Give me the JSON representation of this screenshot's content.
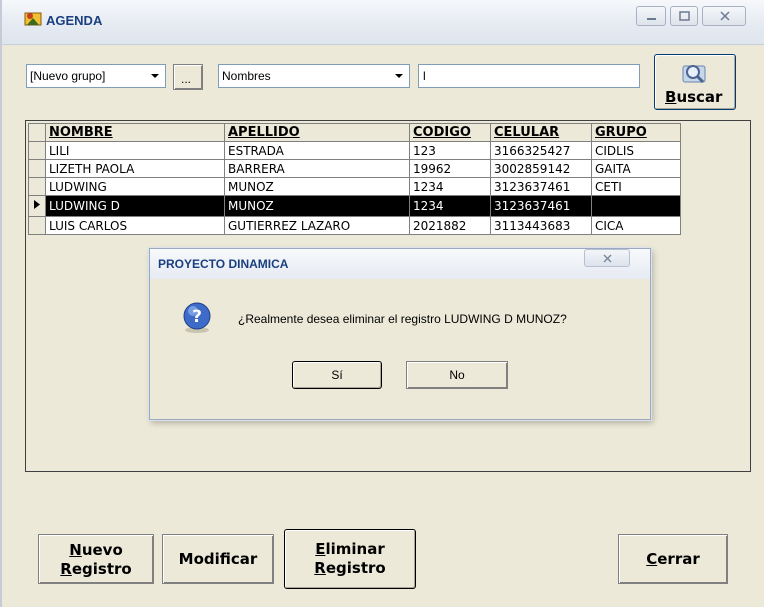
{
  "window": {
    "title": "AGENDA"
  },
  "toolbar": {
    "group_combo": "[Nuevo grupo]",
    "ellipsis": "...",
    "field_combo": "Nombres",
    "search_value": "l",
    "search_button": {
      "mnemonic": "B",
      "rest": "uscar"
    }
  },
  "table": {
    "headers": [
      "NOMBRE",
      "APELLIDO",
      "CODIGO",
      "CELULAR",
      "GRUPO"
    ],
    "rows": [
      [
        "LILI",
        "ESTRADA",
        "123",
        "3166325427",
        "CIDLIS"
      ],
      [
        "LIZETH PAOLA",
        "BARRERA",
        "19962",
        "3002859142",
        "GAITA"
      ],
      [
        "LUDWING",
        "MUNOZ",
        "1234",
        "3123637461",
        "CETI"
      ],
      [
        "LUDWING D",
        "MUNOZ",
        "1234",
        "3123637461",
        ""
      ],
      [
        "LUIS CARLOS",
        "GUTIERREZ LAZARO",
        "2021882",
        "3113443683",
        "CICA"
      ]
    ],
    "selected_index": 3
  },
  "dialog": {
    "title": "PROYECTO DINAMICA",
    "message": "¿Realmente desea eliminar el registro LUDWING D MUNOZ?",
    "yes": "Sí",
    "no": "No"
  },
  "buttons": {
    "nuevo": {
      "line1_mn": "N",
      "line1_rest": "uevo",
      "line2_mn": "R",
      "line2_rest": "egistro"
    },
    "modificar": "Modificar",
    "eliminar": {
      "line1_mn": "E",
      "line1_rest": "liminar",
      "line2_mn": "R",
      "line2_rest": "egistro"
    },
    "cerrar": {
      "mn": "C",
      "rest": "errar"
    }
  },
  "colors": {
    "title_text": "#1a3f80",
    "selected_row": "#000000",
    "window_bg": "#ece9d8"
  },
  "icons": [
    "agenda-app-icon",
    "search-magnifier-icon",
    "question-icon",
    "row-pointer-icon"
  ]
}
